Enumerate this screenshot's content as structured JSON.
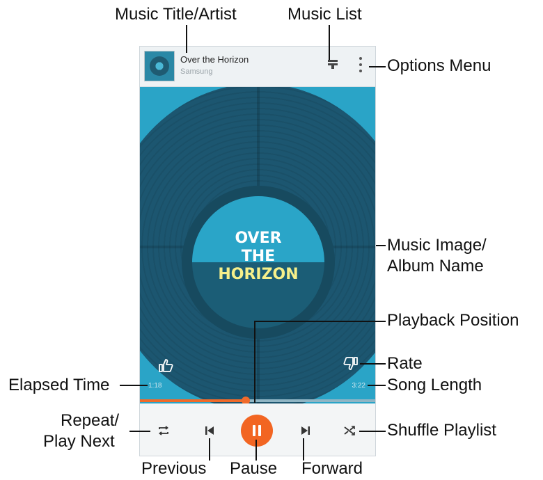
{
  "callouts": {
    "music_title_artist": "Music Title/Artist",
    "music_list": "Music List",
    "options_menu": "Options Menu",
    "music_image": "Music Image/",
    "album_name": "Album Name",
    "playback_position": "Playback Position",
    "rate": "Rate",
    "elapsed_time": "Elapsed Time",
    "song_length": "Song Length",
    "repeat": "Repeat/",
    "play_next": "Play Next",
    "shuffle_playlist": "Shuffle Playlist",
    "previous": "Previous",
    "pause": "Pause",
    "forward": "Forward"
  },
  "player": {
    "song_title": "Over the Horizon",
    "artist": "Samsung",
    "album_art_lines": [
      "OVER",
      "THE",
      "HORIZON"
    ],
    "elapsed": "1:18",
    "length": "3:22",
    "progress": 0.45
  },
  "colors": {
    "accent": "#f26522",
    "art_bg": "#2aa4c7",
    "disc": "#1c5670",
    "label_highlight": "#f7f08a"
  },
  "icons": {
    "thumb": "album-thumbnail",
    "list": "music-list-icon",
    "options": "vertical-dots-icon",
    "like": "thumbs-up-icon",
    "dislike": "thumbs-down-icon",
    "repeat": "repeat-icon",
    "previous": "skip-previous-icon",
    "pause": "pause-icon",
    "next": "skip-next-icon",
    "shuffle": "shuffle-icon"
  }
}
